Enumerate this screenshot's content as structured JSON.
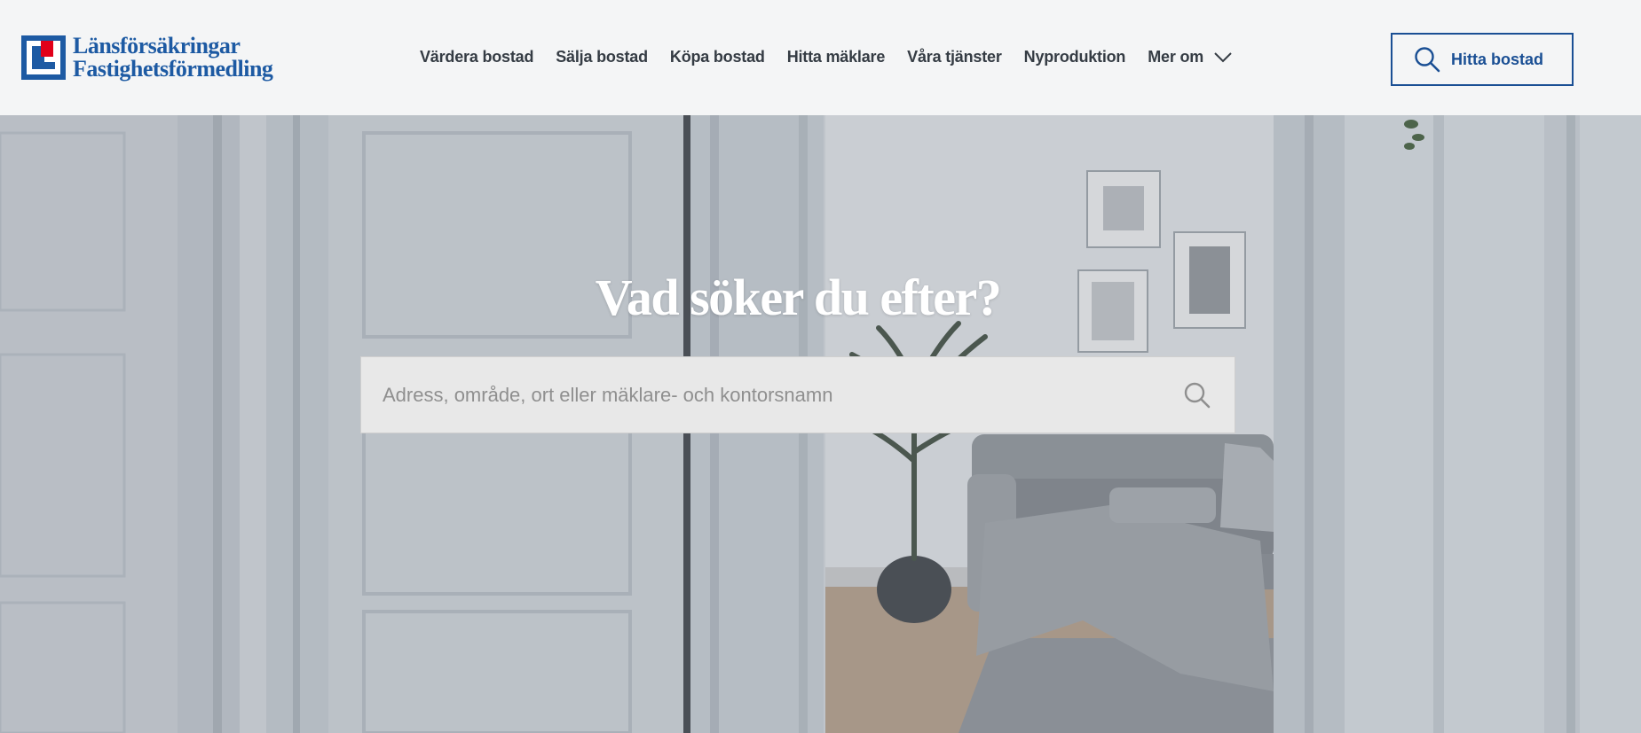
{
  "brand": {
    "line1": "Länsförsäkringar",
    "line2": "Fastighetsförmedling",
    "color": "#1d5aa3",
    "accent_red": "#e1001a",
    "icon": "lf-logo-mark"
  },
  "nav": {
    "items": [
      {
        "label": "Värdera bostad"
      },
      {
        "label": "Sälja bostad"
      },
      {
        "label": "Köpa bostad"
      },
      {
        "label": "Hitta mäklare"
      },
      {
        "label": "Våra tjänster"
      },
      {
        "label": "Nyproduktion"
      }
    ],
    "more_label": "Mer om",
    "more_icon": "chevron-down-icon"
  },
  "find_button": {
    "label": "Hitta bostad",
    "icon": "search-icon",
    "color": "#1a4f94"
  },
  "hero": {
    "headline": "Vad söker du efter?",
    "search_placeholder": "Adress, område, ort eller mäklare- och kontorsnamn",
    "search_value": "",
    "search_icon": "search-icon"
  }
}
